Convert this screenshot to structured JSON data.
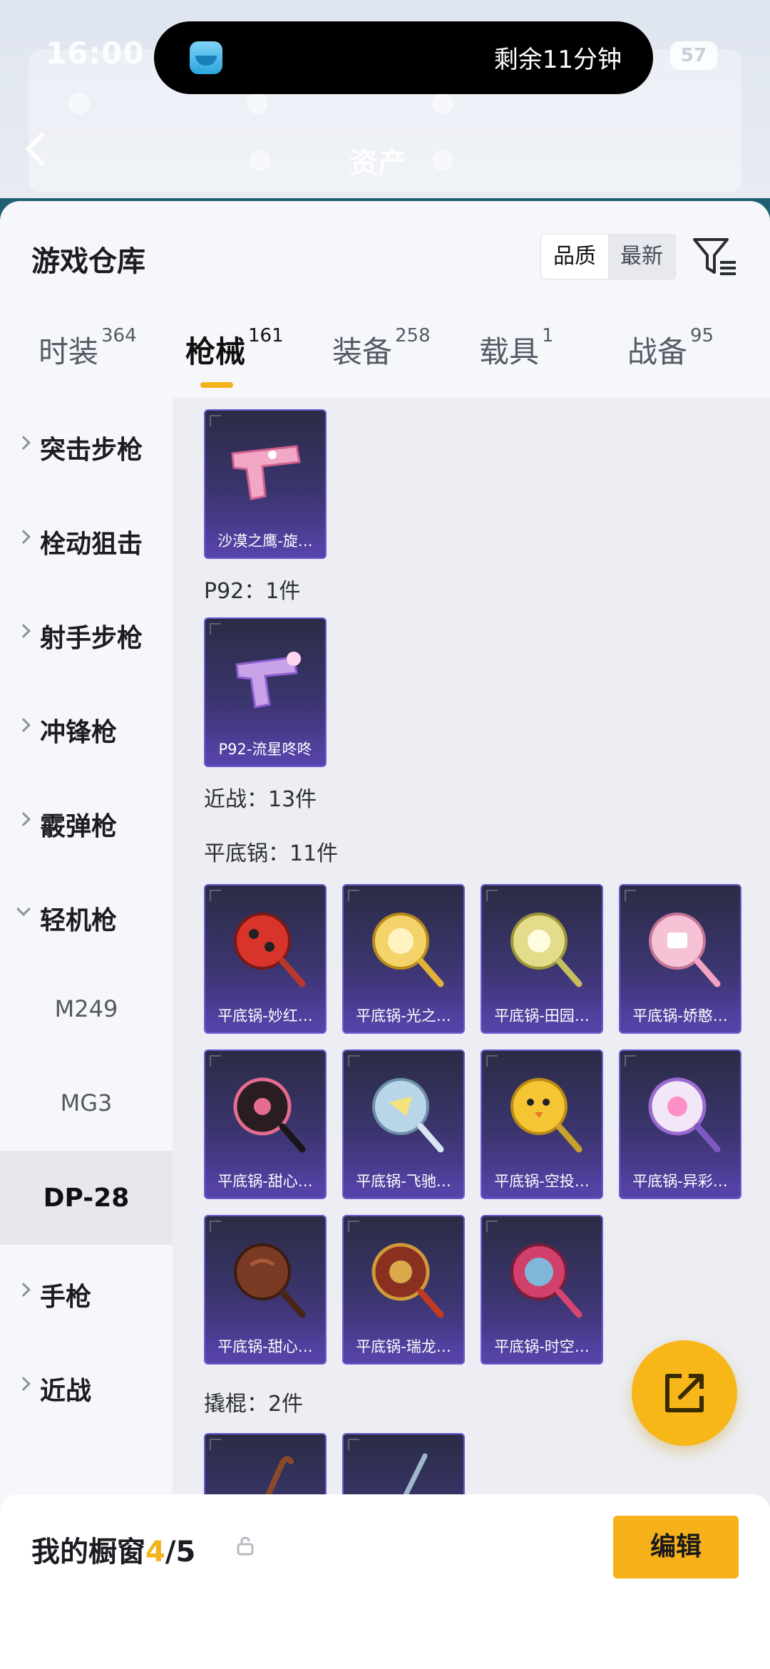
{
  "status_bar": {
    "time": "16:00",
    "timer": "剩余11分钟",
    "battery": "57"
  },
  "header": {
    "title": "资产"
  },
  "panel": {
    "title": "游戏仓库",
    "sort": {
      "active": "品质",
      "other": "最新"
    }
  },
  "tabs": [
    {
      "label": "时装",
      "count": "364"
    },
    {
      "label": "枪械",
      "count": "161"
    },
    {
      "label": "装备",
      "count": "258"
    },
    {
      "label": "载具",
      "count": "1"
    },
    {
      "label": "战备",
      "count": "95"
    }
  ],
  "sidebar": {
    "categories": [
      {
        "label": "突击步枪"
      },
      {
        "label": "栓动狙击"
      },
      {
        "label": "射手步枪"
      },
      {
        "label": "冲锋枪"
      },
      {
        "label": "霰弹枪"
      },
      {
        "label": "轻机枪"
      },
      {
        "label": "手枪"
      },
      {
        "label": "近战"
      }
    ],
    "subs": [
      {
        "label": "M249"
      },
      {
        "label": "MG3"
      },
      {
        "label": "DP-28"
      }
    ]
  },
  "content": {
    "top_items": [
      {
        "label": "沙漠之鹰-旋…"
      }
    ],
    "group_p92": "P92：1件",
    "p92_items": [
      {
        "label": "P92-流星咚咚"
      }
    ],
    "group_melee": "近战：13件",
    "group_pan": "平底锅：11件",
    "pan_items": [
      {
        "label": "平底锅-妙红…"
      },
      {
        "label": "平底锅-光之…"
      },
      {
        "label": "平底锅-田园…"
      },
      {
        "label": "平底锅-娇憨…"
      },
      {
        "label": "平底锅-甜心…"
      },
      {
        "label": "平底锅-飞驰…"
      },
      {
        "label": "平底锅-空投…"
      },
      {
        "label": "平底锅-异彩…"
      },
      {
        "label": "平底锅-甜心…"
      },
      {
        "label": "平底锅-瑞龙…"
      },
      {
        "label": "平底锅-时空…"
      }
    ],
    "group_crowbar": "撬棍：2件"
  },
  "bottom": {
    "label": "我的橱窗",
    "count": "4",
    "total": "/5",
    "edit_label": "编辑"
  },
  "colors": {
    "accent": "#f6b01a",
    "card_bg": "#3b356e",
    "card_border": "#6d5bd0"
  }
}
